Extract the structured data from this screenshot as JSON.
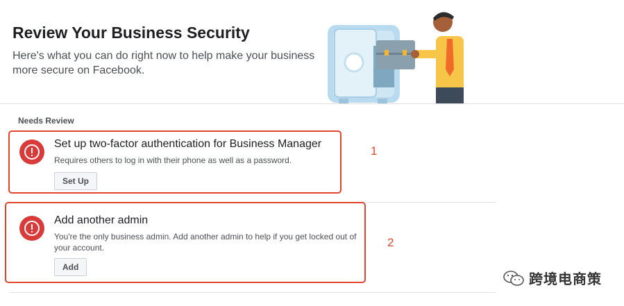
{
  "header": {
    "title": "Review Your Business Security",
    "description": "Here's what you can do right now to help make your business more secure on Facebook."
  },
  "illustration": {
    "name": "safe-illustration"
  },
  "section": {
    "label": "Needs Review"
  },
  "items": [
    {
      "title": "Set up two-factor authentication for Business Manager",
      "description": "Requires others to log in with their phone as well as a password.",
      "button_label": "Set Up",
      "icon": "alert-icon"
    },
    {
      "title": "Add another admin",
      "description": "You're the only business admin. Add another admin to help if you get locked out of your account.",
      "button_label": "Add",
      "icon": "alert-icon"
    }
  ],
  "annotations": {
    "marker_1": "1",
    "marker_2": "2"
  },
  "watermark": {
    "text": "跨境电商策"
  },
  "colors": {
    "alert_red": "#d93a3a",
    "annotation_orange": "#e0452b"
  }
}
